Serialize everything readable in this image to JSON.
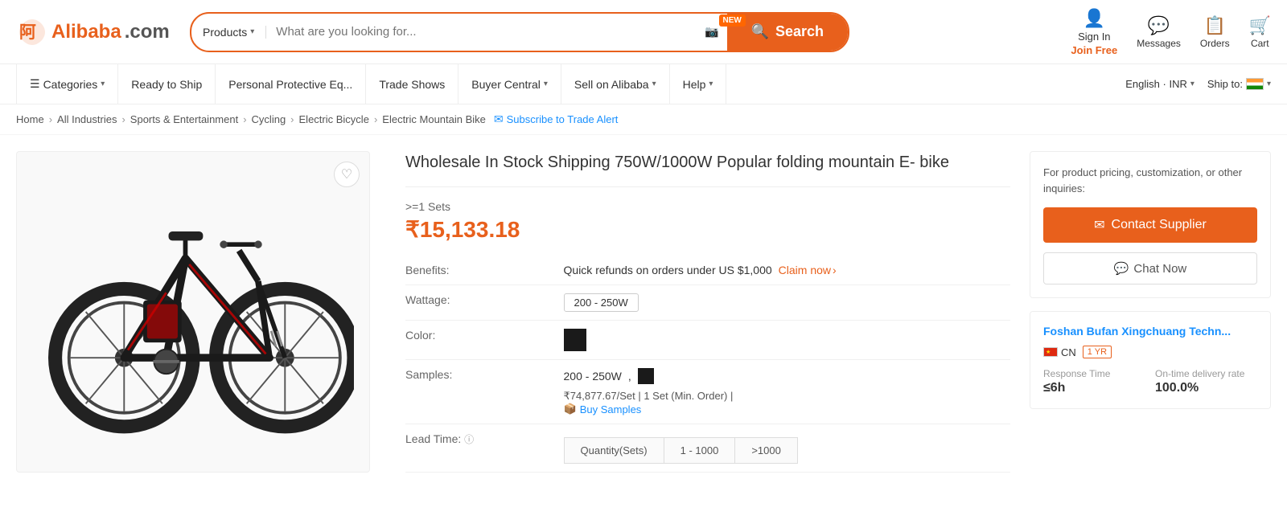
{
  "header": {
    "logo_text": "Alibaba",
    "logo_domain": ".com",
    "search_placeholder": "What are you looking for...",
    "search_btn_label": "Search",
    "products_label": "Products",
    "new_badge": "NEW",
    "sign_in_label": "Sign In",
    "join_free_label": "Join Free",
    "messages_label": "Messages",
    "orders_label": "Orders",
    "cart_label": "Cart"
  },
  "navbar": {
    "categories_label": "Categories",
    "items": [
      {
        "label": "Ready to Ship"
      },
      {
        "label": "Personal Protective Eq..."
      },
      {
        "label": "Trade Shows"
      },
      {
        "label": "Buyer Central"
      },
      {
        "label": "Sell on Alibaba"
      },
      {
        "label": "Help"
      }
    ],
    "language": "English · INR",
    "ship_to": "Ship to:"
  },
  "breadcrumb": {
    "items": [
      {
        "label": "Home"
      },
      {
        "label": "All Industries"
      },
      {
        "label": "Sports & Entertainment"
      },
      {
        "label": "Cycling"
      },
      {
        "label": "Electric Bicycle"
      },
      {
        "label": "Electric Mountain Bike"
      }
    ],
    "subscribe_label": "Subscribe to Trade Alert"
  },
  "product": {
    "title": "Wholesale In Stock Shipping 750W/1000W Popular folding mountain E- bike",
    "min_order_label": ">=1 Sets",
    "price": "₹15,133.18",
    "benefits_label": "Benefits:",
    "benefits_text": "Quick refunds on orders under US $1,000",
    "claim_label": "Claim now",
    "wattage_label": "Wattage:",
    "wattage_value": "200 - 250W",
    "color_label": "Color:",
    "samples_label": "Samples:",
    "samples_config": "200 - 250W",
    "samples_price_text": "₹74,877.67/Set | 1 Set (Min. Order) |",
    "buy_samples_label": "Buy Samples",
    "lead_time_label": "Lead Time:",
    "lead_time_cols": [
      "Quantity(Sets)",
      "1 - 1000",
      ">1000"
    ],
    "lead_time_hint": "Lead Time"
  },
  "supplier": {
    "name": "Foshan Bufan Xingchuang Techn...",
    "country_code": "CN",
    "year_badge": "1 YR",
    "response_time_label": "Response Time",
    "response_time_value": "≤6h",
    "delivery_rate_label": "On-time delivery rate",
    "delivery_rate_value": "100.0%"
  },
  "sidebar": {
    "inquiry_text": "For product pricing, customization, or other inquiries:",
    "contact_btn_label": "Contact Supplier",
    "chat_btn_label": "Chat Now"
  }
}
